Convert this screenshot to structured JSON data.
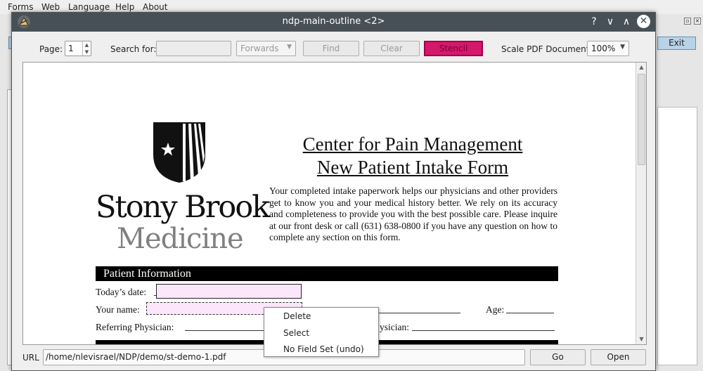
{
  "background": {
    "menu": [
      "Forms",
      "Web",
      "Language",
      "Help",
      "About"
    ],
    "exit_label": "Exit"
  },
  "window": {
    "title": "ndp-main-outline <2>",
    "controls": {
      "help": "?",
      "minimize": "∨",
      "maximize": "∧",
      "close": "✕"
    }
  },
  "toolbar": {
    "page_label": "Page:",
    "page_value": "1",
    "search_label": "Search for:",
    "search_value": "",
    "direction": "Forwards",
    "find_label": "Find",
    "clear_label": "Clear",
    "stencil_label": "Stencil",
    "scale_label": "Scale PDF Document:",
    "scale_value": "100%"
  },
  "document": {
    "logo_name": "Stony Brook",
    "logo_sub": "Medicine",
    "title_line1": "Center for Pain Management",
    "title_line2": "New Patient Intake Form",
    "paragraph": "Your completed intake paperwork helps our physicians and other providers get to know you and your medical history better.  We rely on its accuracy and completeness to provide you with the best possible care.  Please inquire at our front desk or call (631) 638-0800 if you have any question on how to complete any section on this form.",
    "section": "Patient Information",
    "todays_date_label": "Today’s date:",
    "your_name_label": "Your name:",
    "age_label": "Age:",
    "referring_label": "Referring Physician:",
    "physician_partial": "ysician:"
  },
  "context_menu": {
    "items": [
      "Delete",
      "Select",
      "No Field Set (undo)"
    ]
  },
  "bottom": {
    "url_label": "URL",
    "url_value": "/home/nlevisrael/NDP/demo/st-demo-1.pdf",
    "go_label": "Go",
    "open_label": "Open"
  },
  "colors": {
    "titlebar": "#475057",
    "stencil": "#d4186c",
    "field_fill": "#fbe6fb"
  }
}
